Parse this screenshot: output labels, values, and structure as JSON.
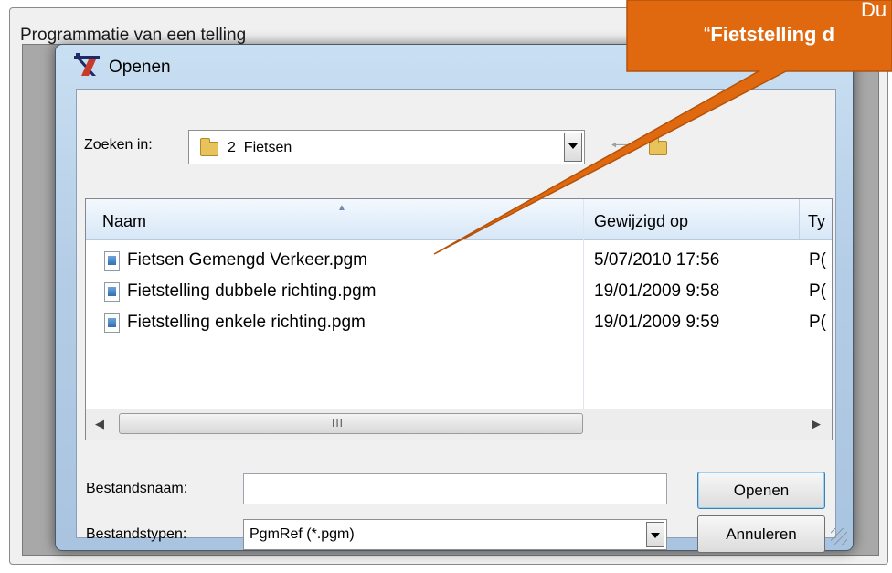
{
  "outer": {
    "title": "Programmatie van een telling"
  },
  "dialog": {
    "title": "Openen",
    "look_in_label": "Zoeken in:",
    "look_in_value": "2_Fietsen",
    "columns": {
      "name": "Naam",
      "date": "Gewijzigd op",
      "type": "Ty"
    },
    "files": [
      {
        "name": "Fietsen Gemengd Verkeer.pgm",
        "date": "5/07/2010 17:56",
        "type": "P("
      },
      {
        "name": "Fietstelling dubbele richting.pgm",
        "date": "19/01/2009 9:58",
        "type": "P("
      },
      {
        "name": "Fietstelling enkele richting.pgm",
        "date": "19/01/2009 9:59",
        "type": "P("
      }
    ],
    "scroll_grip": "III",
    "filename_label": "Bestandsnaam:",
    "filename_value": "",
    "filetype_label": "Bestandstypen:",
    "filetype_value": "PgmRef (*.pgm)",
    "open_button": "Openen",
    "cancel_button": "Annuleren"
  },
  "callout": {
    "line1": "Du",
    "line2_prefix": "“",
    "line2_bold": "Fietstelling d",
    "color": "#e0690f"
  }
}
